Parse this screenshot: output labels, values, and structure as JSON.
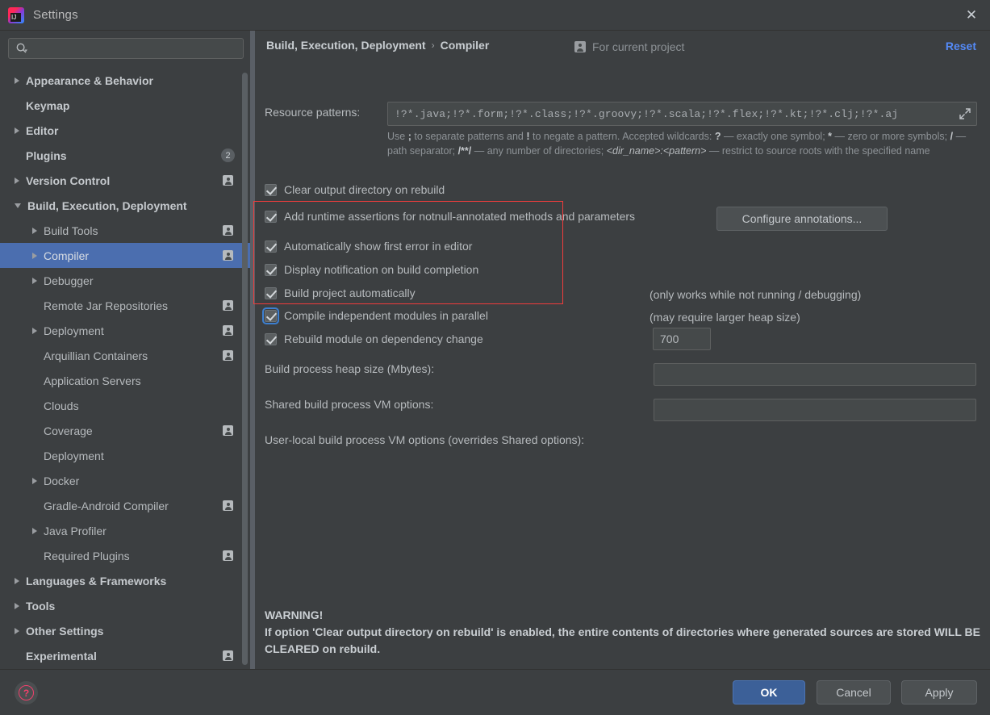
{
  "window": {
    "title": "Settings",
    "app_icon": "intellij-idea-icon",
    "close_icon": "close-icon"
  },
  "sidebar": {
    "search": {
      "placeholder": "",
      "value": "",
      "icon": "search-icon"
    },
    "items": [
      {
        "label": "Appearance & Behavior",
        "arrow": "right",
        "indent": 0,
        "bold": true,
        "badge": ""
      },
      {
        "label": "Keymap",
        "arrow": "none",
        "indent": 0,
        "bold": true,
        "badge": ""
      },
      {
        "label": "Editor",
        "arrow": "right",
        "indent": 0,
        "bold": true,
        "badge": ""
      },
      {
        "label": "Plugins",
        "arrow": "none",
        "indent": 0,
        "bold": true,
        "badge": "count",
        "count": "2"
      },
      {
        "label": "Version Control",
        "arrow": "right",
        "indent": 0,
        "bold": true,
        "badge": "person"
      },
      {
        "label": "Build, Execution, Deployment",
        "arrow": "down",
        "indent": 0,
        "bold": true,
        "badge": ""
      },
      {
        "label": "Build Tools",
        "arrow": "right",
        "indent": 1,
        "bold": false,
        "badge": "person"
      },
      {
        "label": "Compiler",
        "arrow": "right",
        "indent": 1,
        "bold": false,
        "badge": "person",
        "selected": true
      },
      {
        "label": "Debugger",
        "arrow": "right",
        "indent": 1,
        "bold": false,
        "badge": ""
      },
      {
        "label": "Remote Jar Repositories",
        "arrow": "none",
        "indent": 1,
        "bold": false,
        "badge": "person"
      },
      {
        "label": "Deployment",
        "arrow": "right",
        "indent": 1,
        "bold": false,
        "badge": "person"
      },
      {
        "label": "Arquillian Containers",
        "arrow": "none",
        "indent": 1,
        "bold": false,
        "badge": "person"
      },
      {
        "label": "Application Servers",
        "arrow": "none",
        "indent": 1,
        "bold": false,
        "badge": ""
      },
      {
        "label": "Clouds",
        "arrow": "none",
        "indent": 1,
        "bold": false,
        "badge": ""
      },
      {
        "label": "Coverage",
        "arrow": "none",
        "indent": 1,
        "bold": false,
        "badge": "person"
      },
      {
        "label": "Deployment",
        "arrow": "none",
        "indent": 1,
        "bold": false,
        "badge": ""
      },
      {
        "label": "Docker",
        "arrow": "right",
        "indent": 1,
        "bold": false,
        "badge": ""
      },
      {
        "label": "Gradle-Android Compiler",
        "arrow": "none",
        "indent": 1,
        "bold": false,
        "badge": "person"
      },
      {
        "label": "Java Profiler",
        "arrow": "right",
        "indent": 1,
        "bold": false,
        "badge": ""
      },
      {
        "label": "Required Plugins",
        "arrow": "none",
        "indent": 1,
        "bold": false,
        "badge": "person"
      },
      {
        "label": "Languages & Frameworks",
        "arrow": "right",
        "indent": 0,
        "bold": true,
        "badge": ""
      },
      {
        "label": "Tools",
        "arrow": "right",
        "indent": 0,
        "bold": true,
        "badge": ""
      },
      {
        "label": "Other Settings",
        "arrow": "right",
        "indent": 0,
        "bold": true,
        "badge": ""
      },
      {
        "label": "Experimental",
        "arrow": "none",
        "indent": 0,
        "bold": true,
        "badge": "person"
      }
    ]
  },
  "main": {
    "breadcrumb_root": "Build, Execution, Deployment",
    "breadcrumb_sep": "›",
    "breadcrumb_leaf": "Compiler",
    "scope_label": "For current project",
    "scope_icon": "person-icon",
    "reset_label": "Reset",
    "resource_patterns_label": "Resource patterns:",
    "resource_patterns_value": "!?*.java;!?*.form;!?*.class;!?*.groovy;!?*.scala;!?*.flex;!?*.kt;!?*.clj;!?*.aj",
    "expand_icon": "expand-diagonal-icon",
    "hint_line1_a": "Use ",
    "hint_semicolon": ";",
    "hint_line1_b": " to separate patterns and ",
    "hint_bang": "!",
    "hint_line1_c": " to negate a pattern. Accepted wildcards: ",
    "hint_q": "?",
    "hint_line1_d": " — exactly one symbol; ",
    "hint_star": "*",
    "hint_line1_e": " — zero or more symbols; ",
    "hint_slash": "/",
    "hint_line2_a": " — path separator; ",
    "hint_globdir": "/**/",
    "hint_line2_b": " — any number of directories;  ",
    "hint_dirname": "<dir_name>:<pattern>",
    "hint_line2_c": " — restrict to source roots with the specified name",
    "checkboxes": [
      {
        "label": "Clear output directory on rebuild",
        "checked": true,
        "focused": false,
        "note": ""
      },
      {
        "label": "Add runtime assertions for notnull-annotated methods and parameters",
        "checked": true,
        "focused": false,
        "note": ""
      },
      {
        "label": "Automatically show first error in editor",
        "checked": true,
        "focused": false,
        "note": ""
      },
      {
        "label": "Display notification on build completion",
        "checked": true,
        "focused": false,
        "note": ""
      },
      {
        "label": "Build project automatically",
        "checked": true,
        "focused": false,
        "note": "(only works while not running / debugging)"
      },
      {
        "label": "Compile independent modules in parallel",
        "checked": true,
        "focused": true,
        "note": "(may require larger heap size)"
      },
      {
        "label": "Rebuild module on dependency change",
        "checked": true,
        "focused": false,
        "note": ""
      }
    ],
    "configure_annotations_label": "Configure annotations...",
    "heap_label": "Build process heap size (Mbytes):",
    "heap_value": "700",
    "shared_vm_label": "Shared build process VM options:",
    "shared_vm_value": "",
    "user_vm_label": "User-local build process VM options (overrides Shared options):",
    "user_vm_value": "",
    "warning_title": "WARNING!",
    "warning_body": "If option 'Clear output directory on rebuild' is enabled, the entire contents of directories where generated sources are stored WILL BE CLEARED on rebuild."
  },
  "footer": {
    "help_icon": "help-question-icon",
    "ok_label": "OK",
    "cancel_label": "Cancel",
    "apply_label": "Apply"
  },
  "colors": {
    "window_bg": "#3c3f41",
    "selection_blue": "#4b6eaf",
    "link_blue": "#548af7",
    "highlight_red": "#f03c3c",
    "ok_button": "#3c6098"
  }
}
